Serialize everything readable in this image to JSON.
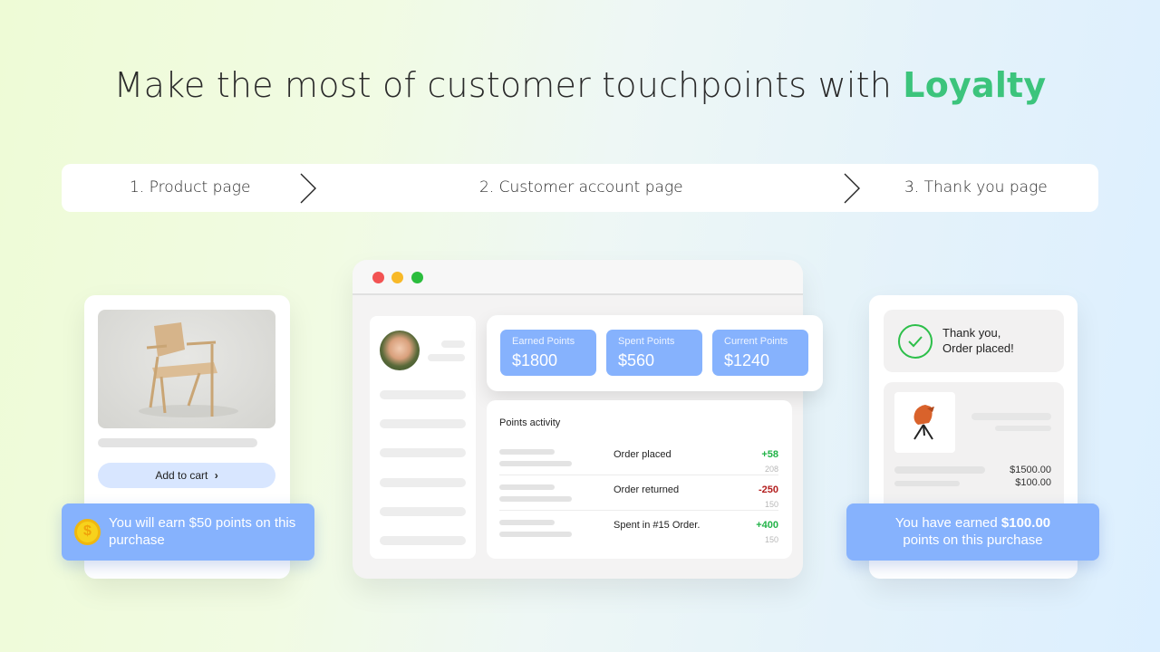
{
  "headline": {
    "prefix": "Make the most of customer touchpoints with",
    "accent": "Loyalty",
    "accent_color": "#3cc47c"
  },
  "steps": [
    {
      "label": "1. Product page"
    },
    {
      "label": "2. Customer account page"
    },
    {
      "label": "3. Thank you page"
    }
  ],
  "product_page": {
    "image": "wooden-chair-photo",
    "add_to_cart_label": "Add to cart",
    "add_to_cart_icon": "chevron-right-icon",
    "points_banner": {
      "icon": "coin-icon",
      "text": "You will earn $50 points on this purchase"
    }
  },
  "account_page": {
    "window_controls": [
      "close",
      "minimize",
      "maximize"
    ],
    "avatar": "user-avatar",
    "stats": [
      {
        "label": "Earned Points",
        "value": "$1800"
      },
      {
        "label": "Spent Points",
        "value": "$560"
      },
      {
        "label": "Current Points",
        "value": "$1240"
      }
    ],
    "activity": {
      "title": "Points activity",
      "rows": [
        {
          "name": "Order placed",
          "delta": "+58",
          "balance": "208",
          "type": "positive"
        },
        {
          "name": "Order returned",
          "delta": "-250",
          "balance": "150",
          "type": "negative"
        },
        {
          "name": "Spent in #15 Order.",
          "delta": "+400",
          "balance": "150",
          "type": "positive"
        }
      ],
      "positive_color": "#22b348",
      "negative_color": "#b31f1f"
    }
  },
  "thank_you_page": {
    "message_line1": "Thank you,",
    "message_line2": "Order placed!",
    "product_image": "orange-chair-photo",
    "prices": [
      "$1500.00",
      "$100.00"
    ],
    "points_banner": {
      "prefix": "You have earned",
      "amount": "$100.00",
      "suffix": "points on this purchase"
    }
  },
  "colors": {
    "banner_blue": "#86b2fd",
    "button_light_blue": "#d8e6ff"
  }
}
